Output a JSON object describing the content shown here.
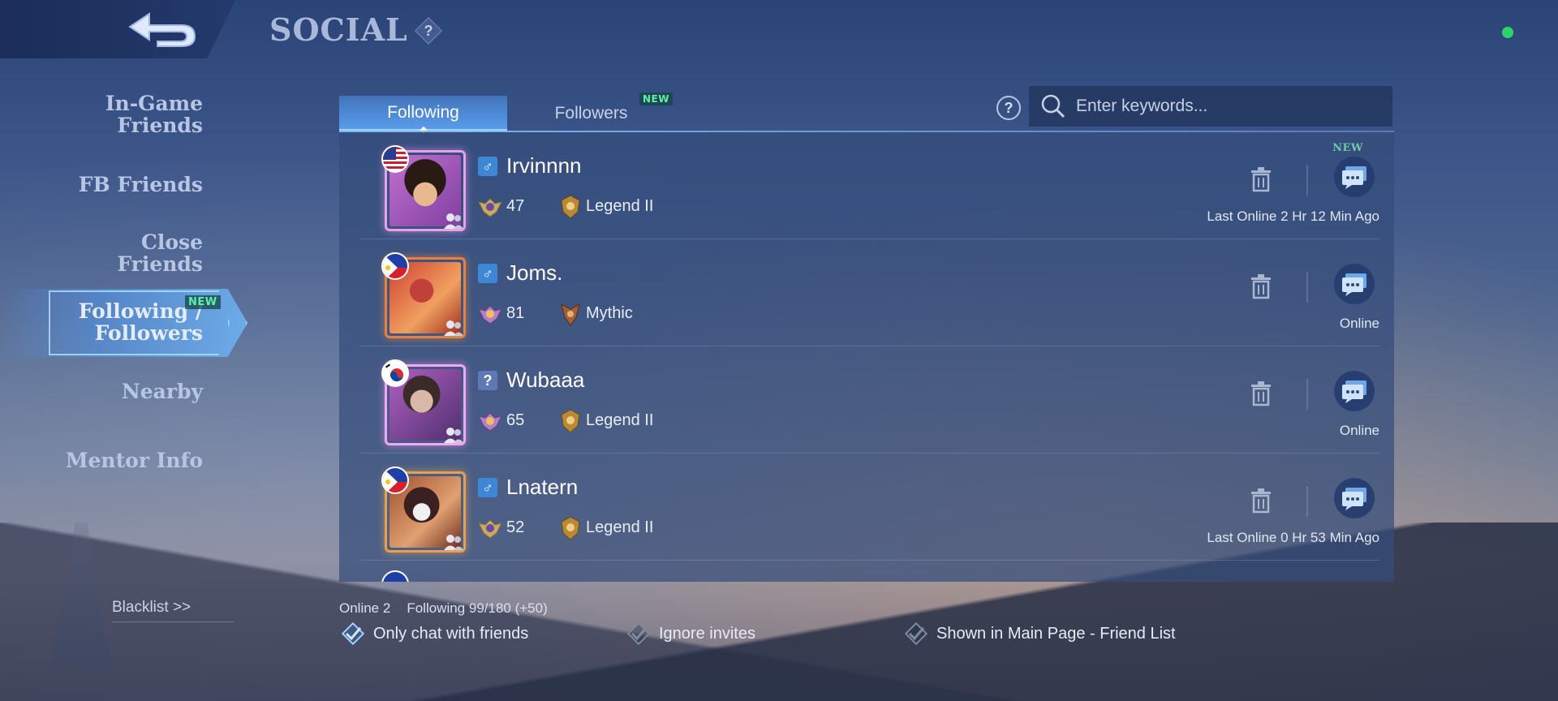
{
  "header": {
    "title": "SOCIAL",
    "help_label": "?",
    "back_icon": "back-arrow-icon",
    "status_color": "#2bd46b"
  },
  "sidebar": {
    "items": [
      {
        "label": "In-Game\nFriends"
      },
      {
        "label": "FB Friends"
      },
      {
        "label": "Close\nFriends"
      },
      {
        "label": "Following /\nFollowers",
        "badge": "NEW",
        "active": true
      },
      {
        "label": "Nearby"
      },
      {
        "label": "Mentor Info"
      }
    ],
    "blacklist": "Blacklist >>"
  },
  "tabs": [
    {
      "label": "Following",
      "active": true
    },
    {
      "label": "Followers",
      "badge": "NEW"
    }
  ],
  "search": {
    "placeholder": "Enter keywords...",
    "help_label": "?"
  },
  "panel_badge": "NEW",
  "rows": [
    {
      "name": "Irvinnnn",
      "gender": "♂",
      "level": "47",
      "rank": "Legend II",
      "status": "Last Online 2 Hr 12 Min Ago",
      "flag": "US"
    },
    {
      "name": "Joms.",
      "gender": "♂",
      "level": "81",
      "rank": "Mythic",
      "status": "Online",
      "flag": "PH"
    },
    {
      "name": "Wubaaa",
      "gender": "?",
      "level": "65",
      "rank": "Legend II",
      "status": "Online",
      "flag": "KR"
    },
    {
      "name": "Lnatern",
      "gender": "♂",
      "level": "52",
      "rank": "Legend II",
      "status": "Last Online 0 Hr 53 Min Ago",
      "flag": "PH"
    }
  ],
  "footer": {
    "online": "Online 2",
    "following": "Following 99/180 (+50)",
    "options": [
      {
        "label": "Only chat with friends",
        "checked": true
      },
      {
        "label": "Ignore invites",
        "checked": false
      },
      {
        "label": "Shown in Main Page - Friend List",
        "checked": false
      }
    ]
  },
  "colors": {
    "accent": "#7fb8f0",
    "online_dot": "#2bd46b",
    "new_badge": "#5ff0a6"
  }
}
